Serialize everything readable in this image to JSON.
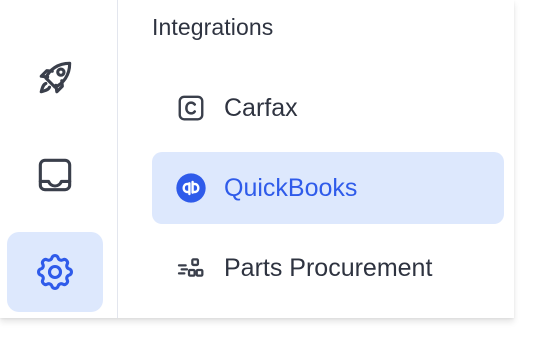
{
  "rail": {
    "items": [
      {
        "icon": "rocket-icon",
        "active": false
      },
      {
        "icon": "inbox-icon",
        "active": false
      },
      {
        "icon": "gear-icon",
        "active": true
      }
    ]
  },
  "panel": {
    "heading": "Integrations",
    "items": [
      {
        "label": "Carfax",
        "icon": "carfax-c-icon",
        "active": false
      },
      {
        "label": "QuickBooks",
        "icon": "quickbooks-logo-icon",
        "active": true
      },
      {
        "label": "Parts Procurement",
        "icon": "parts-procurement-icon",
        "active": false
      }
    ]
  },
  "colors": {
    "accent": "#2f5bea",
    "active_bg": "#dde8fd",
    "text": "#2e3340",
    "icon": "#3a3f4b"
  }
}
